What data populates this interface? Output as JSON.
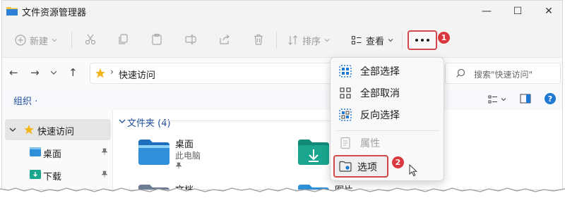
{
  "window": {
    "title": "文件资源管理器",
    "controls": {
      "minimize": "—",
      "maximize": "☐",
      "close": "✕"
    }
  },
  "toolbar": {
    "new_label": "新建",
    "sort_label": "排序",
    "view_label": "查看",
    "more_badge": "1"
  },
  "address": {
    "path": "快速访问",
    "search_placeholder": "搜索\"快速访问\""
  },
  "org": {
    "label": "组织"
  },
  "navpane": {
    "items": [
      {
        "label": "快速访问"
      },
      {
        "label": "桌面"
      },
      {
        "label": "下载"
      }
    ]
  },
  "content": {
    "group_header": "文件夹 (4)",
    "folders": [
      {
        "name": "桌面",
        "sub": "此电脑"
      },
      {
        "name": "文档"
      },
      {
        "name": "图片"
      }
    ]
  },
  "menu": {
    "items": [
      {
        "label": "全部选择"
      },
      {
        "label": "全部取消"
      },
      {
        "label": "反向选择"
      },
      {
        "label": "属性"
      },
      {
        "label": "选项"
      }
    ],
    "options_badge": "2"
  },
  "colors": {
    "accent": "#0067c0",
    "highlight": "#d3474a",
    "folder": "#2f8fd8"
  }
}
